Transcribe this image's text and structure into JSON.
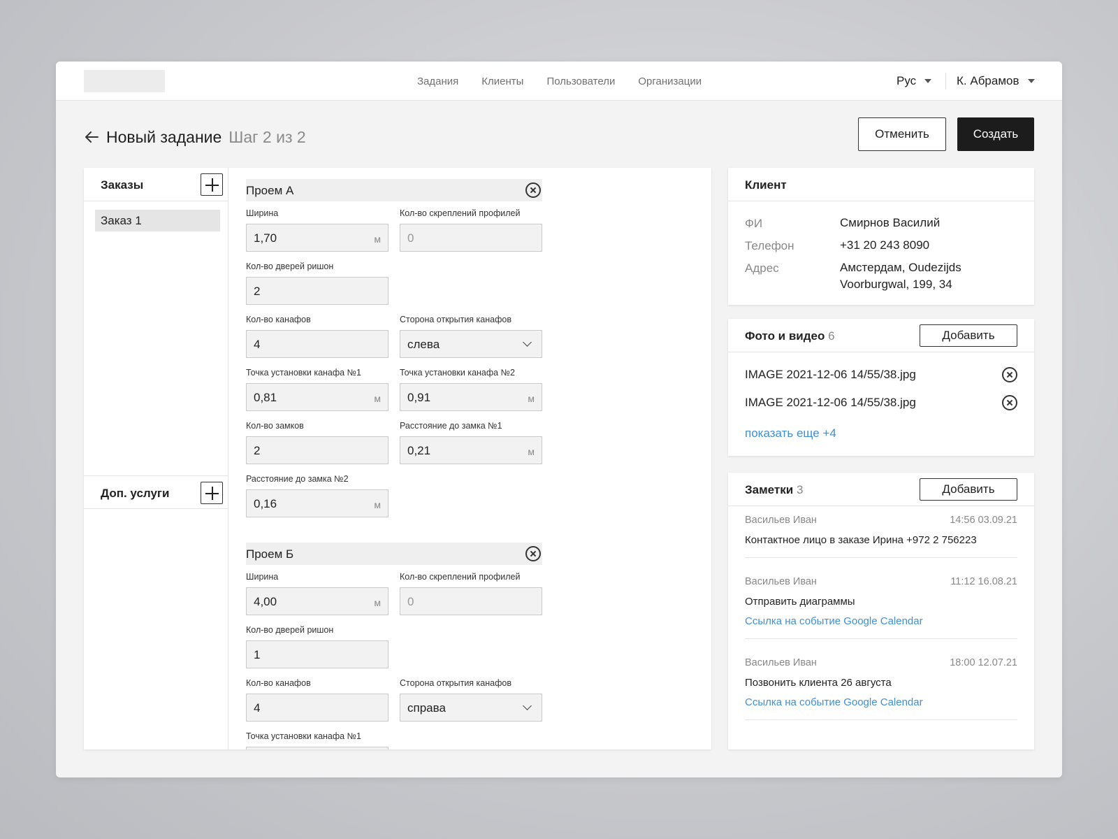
{
  "nav": {
    "items": [
      "Задания",
      "Клиенты",
      "Пользователи",
      "Организации"
    ],
    "language": "Рус",
    "user": "К. Абрамов"
  },
  "header": {
    "title": "Новый задание",
    "step": "Шаг 2 из 2",
    "cancel_label": "Отменить",
    "create_label": "Создать"
  },
  "sidebar": {
    "orders_label": "Заказы",
    "orders": [
      "Заказ 1"
    ],
    "services_label": "Доп. услуги"
  },
  "openings": [
    {
      "title": "Проем А",
      "width_label": "Ширина",
      "width_value": "1,70",
      "width_unit": "м",
      "fasteners_label": "Кол-во скреплений профилей",
      "fasteners_placeholder": "0",
      "doors_label": "Кол-во дверей ришон",
      "doors_value": "2",
      "canopies_label": "Кол-во канафов",
      "canopies_value": "4",
      "side_label": "Сторона открытия канафов",
      "side_value": "слева",
      "point1_label": "Точка установки канафа №1",
      "point1_value": "0,81",
      "point1_unit": "м",
      "point2_label": "Точка установки канафа №2",
      "point2_value": "0,91",
      "point2_unit": "м",
      "locks_label": "Кол-во замков",
      "locks_value": "2",
      "lock1_label": "Расстояние до замка №1",
      "lock1_value": "0,21",
      "lock1_unit": "м",
      "lock2_label": "Расстояние до замка №2",
      "lock2_value": "0,16",
      "lock2_unit": "м"
    },
    {
      "title": "Проем Б",
      "width_label": "Ширина",
      "width_value": "4,00",
      "width_unit": "м",
      "fasteners_label": "Кол-во скреплений профилей",
      "fasteners_placeholder": "0",
      "doors_label": "Кол-во дверей ришон",
      "doors_value": "1",
      "canopies_label": "Кол-во канафов",
      "canopies_value": "4",
      "side_label": "Сторона открытия канафов",
      "side_value": "справа",
      "point1_label": "Точка установки канафа №1"
    }
  ],
  "client": {
    "title": "Клиент",
    "name_label": "ФИ",
    "name_value": "Смирнов Василий",
    "phone_label": "Телефон",
    "phone_value": "+31 20 243 8090",
    "address_label": "Адрес",
    "address_line1": "Амстердам, Oudezijds",
    "address_line2": "Voorburgwal, 199, 34"
  },
  "media": {
    "title": "Фото и видео",
    "count": "6",
    "add_label": "Добавить",
    "files": [
      "IMAGE 2021-12-06 14/55/38.jpg",
      "IMAGE 2021-12-06 14/55/38.jpg"
    ],
    "more_label": "показать еще +4"
  },
  "notes": {
    "title": "Заметки",
    "count": "3",
    "add_label": "Добавить",
    "items": [
      {
        "author": "Васильев Иван",
        "time": "14:56 03.09.21",
        "text": "Контактное лицо в заказе Ирина +972 2 756223",
        "link": ""
      },
      {
        "author": "Васильев Иван",
        "time": "11:12 16.08.21",
        "text": "Отправить диаграммы",
        "link": "Ссылка на событие Google Calendar"
      },
      {
        "author": "Васильев Иван",
        "time": "18:00 12.07.21",
        "text": "Позвонить клиента 26 августа",
        "link": "Ссылка на событие Google Calendar"
      }
    ]
  },
  "colors": {
    "accent_link": "#3f8fd8",
    "primary_button": "#1c1c1c",
    "page_background": "#f3f3f3"
  }
}
